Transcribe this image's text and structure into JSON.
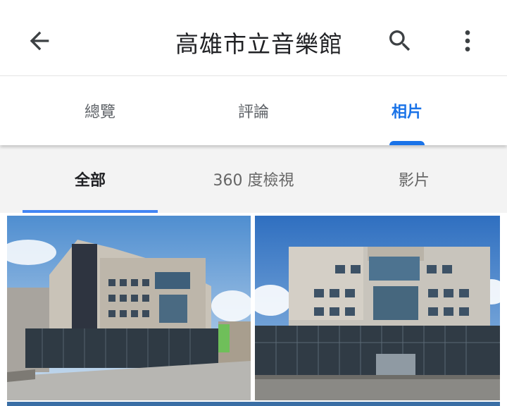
{
  "header": {
    "title": "高雄市立音樂館",
    "back_icon": "arrow-back-icon",
    "search_icon": "search-icon",
    "more_icon": "more-vert-icon"
  },
  "tabs": [
    {
      "label": "總覽",
      "active": false
    },
    {
      "label": "評論",
      "active": false
    },
    {
      "label": "相片",
      "active": true
    }
  ],
  "subtabs": [
    {
      "label": "全部",
      "active": true
    },
    {
      "label": "360 度檢視",
      "active": false
    },
    {
      "label": "影片",
      "active": false
    }
  ],
  "colors": {
    "accent": "#1a73e8",
    "subtab_indicator": "#4285f4",
    "text_primary": "#202124",
    "text_secondary": "#5f6368"
  }
}
